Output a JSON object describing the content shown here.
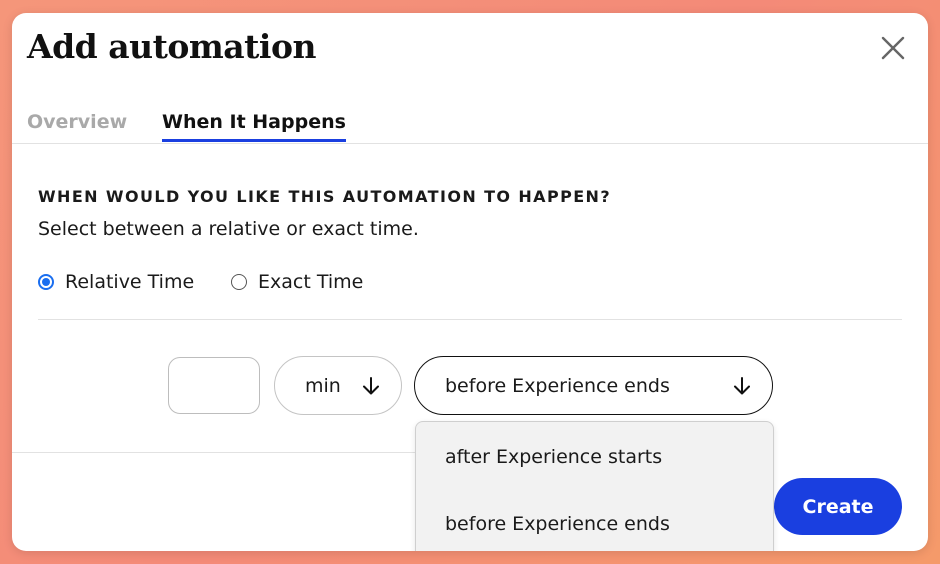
{
  "modal": {
    "title": "Add automation",
    "close_icon": "close-icon",
    "tabs": [
      {
        "label": "Overview",
        "active": false
      },
      {
        "label": "When It Happens",
        "active": true
      }
    ]
  },
  "timing": {
    "heading": "WHEN WOULD YOU LIKE THIS AUTOMATION TO HAPPEN?",
    "subtitle": "Select between a relative or exact time.",
    "options": [
      {
        "label": "Relative Time",
        "selected": true
      },
      {
        "label": "Exact Time",
        "selected": false
      }
    ]
  },
  "relative": {
    "amount_value": "",
    "unit_value": "min",
    "event_value": "before Experience ends",
    "dropdown_options": [
      "after Experience starts",
      "before Experience ends"
    ],
    "arrow_icon": "arrow-down-icon"
  },
  "footer": {
    "create_label": "Create"
  },
  "colors": {
    "accent": "#1a3fe0",
    "radio": "#1a6ef0",
    "background": "#f5967a"
  }
}
